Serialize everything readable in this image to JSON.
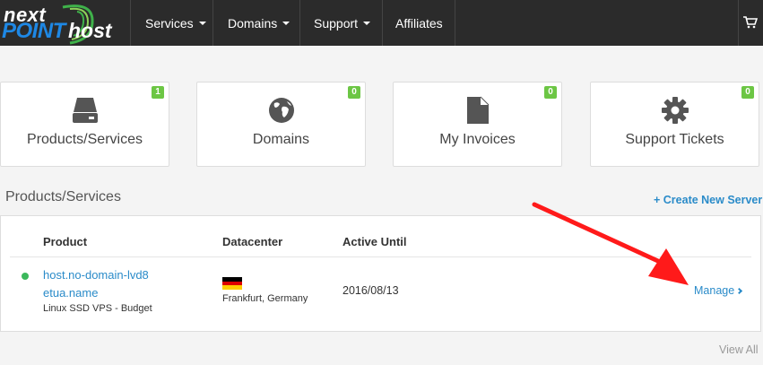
{
  "brand": {
    "logo_line1": "next",
    "logo_word_a": "POINT",
    "logo_word_b": "host"
  },
  "nav": {
    "items": [
      {
        "label": "Services",
        "has_dropdown": true
      },
      {
        "label": "Domains",
        "has_dropdown": true
      },
      {
        "label": "Support",
        "has_dropdown": true
      },
      {
        "label": "Affiliates",
        "has_dropdown": false
      }
    ],
    "cart_icon": "cart-icon"
  },
  "tiles": [
    {
      "label": "Products/Services",
      "count": "1",
      "icon": "server-icon"
    },
    {
      "label": "Domains",
      "count": "0",
      "icon": "globe-icon"
    },
    {
      "label": "My Invoices",
      "count": "0",
      "icon": "document-icon"
    },
    {
      "label": "Support Tickets",
      "count": "0",
      "icon": "gear-icon"
    }
  ],
  "products_section": {
    "title": "Products/Services",
    "create_link": "+ Create New Server",
    "columns": [
      "Product",
      "Datacenter",
      "Active Until"
    ],
    "rows": [
      {
        "status": "active",
        "product_name": "host.no-domain-lvd8etua.name",
        "product_plan": "Linux SSD VPS - Budget",
        "datacenter": "Frankfurt, Germany",
        "flag_icon": "germany-flag-icon",
        "active_until": "2016/08/13",
        "action_label": "Manage"
      }
    ],
    "view_all": "View All"
  },
  "colors": {
    "topbar": "#2b2b2b",
    "badge": "#6cc644",
    "link": "#2a8bc9",
    "status_active": "#3cb85c",
    "annotation_arrow": "#ff1a1a"
  }
}
